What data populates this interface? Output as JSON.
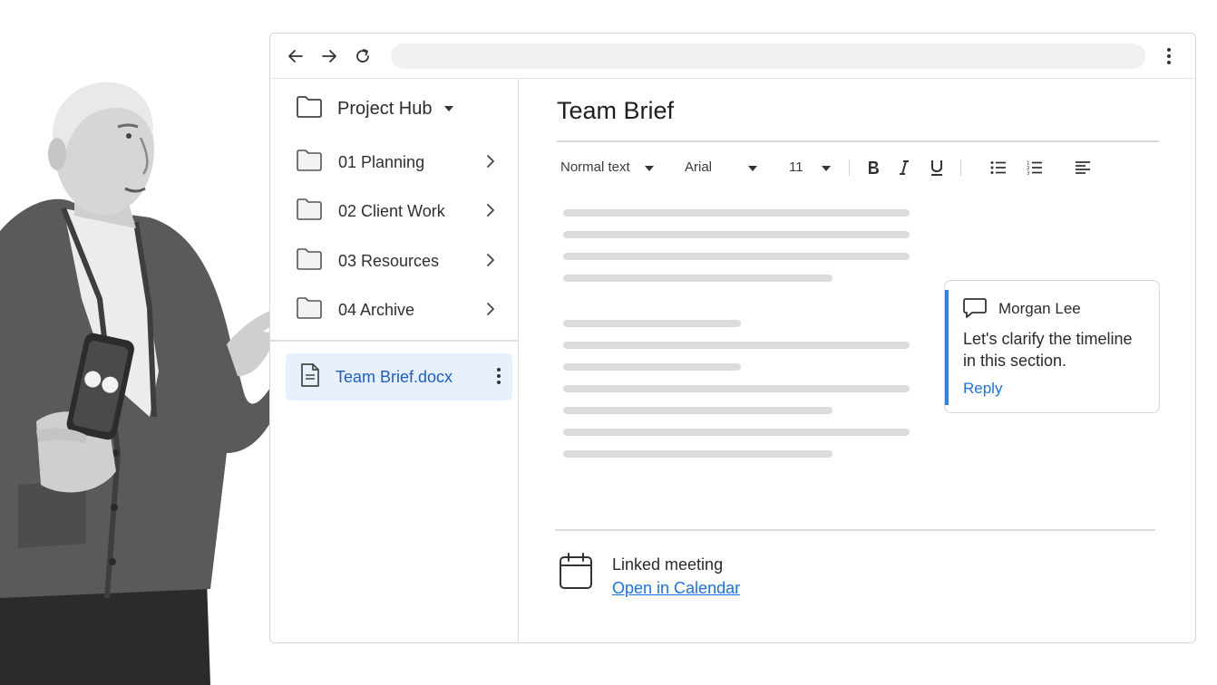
{
  "sidebar": {
    "header_label": "Project Hub",
    "folders": [
      {
        "label": "01 Planning"
      },
      {
        "label": "02 Client Work"
      },
      {
        "label": "03 Resources"
      },
      {
        "label": "04 Archive"
      }
    ],
    "file": {
      "label": "Team Brief.docx"
    }
  },
  "document": {
    "title": "Team Brief",
    "toolbar": {
      "style": "Normal text",
      "font": "Arial",
      "size": "11",
      "buttons": [
        "bold-icon",
        "italic-icon",
        "underline-icon",
        "bulleted-list-icon",
        "numbered-list-icon",
        "align-left-icon"
      ]
    }
  },
  "comment": {
    "author": "Morgan Lee",
    "text": "Let's clarify the timeline in this section.",
    "reply_label": "Reply",
    "accent_color": "#2f80ed"
  },
  "meeting": {
    "label": "Linked meeting",
    "link_text": "Open in Calendar"
  },
  "colors": {
    "link": "#1a73e8",
    "selected_file_bg": "#e8f0fe",
    "selected_file_text": "#1a5fc7"
  }
}
